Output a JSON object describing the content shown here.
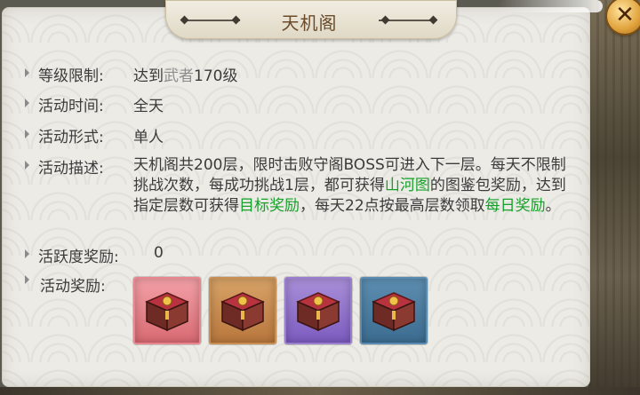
{
  "window": {
    "title": "天机阁",
    "close_symbol": "✕"
  },
  "info": {
    "level_limit": {
      "label": "等级限制:",
      "prefix": "达到",
      "rank": "武者",
      "level": "170级"
    },
    "activity_time": {
      "label": "活动时间:",
      "value": "全天"
    },
    "activity_form": {
      "label": "活动形式:",
      "value": "单人"
    },
    "description": {
      "label": "活动描述:",
      "part1": "天机阁共200层，限时击败守阁BOSS可进入下一层。每天不限制挑战次数，每成功挑战1层，都可获得",
      "highlight1": "山河图",
      "part2": "的图鉴包奖励，达到指定层数可获得",
      "highlight2": "目标奖励",
      "part3": "，每天22点按最高层数领取",
      "highlight3": "每日奖励",
      "part4": "。"
    },
    "activity_points": {
      "label": "活跃度奖励:",
      "value": "0"
    },
    "rewards": {
      "label": "活动奖励:",
      "items": [
        {
          "icon": "treasure-chest-icon",
          "quality_color": "#d96a72"
        },
        {
          "icon": "treasure-chest-icon",
          "quality_color": "#b9773d"
        },
        {
          "icon": "treasure-chest-icon",
          "quality_color": "#7c5cc0"
        },
        {
          "icon": "treasure-chest-icon",
          "quality_color": "#3c6d91"
        }
      ]
    }
  },
  "colors": {
    "highlight": "#16a12a",
    "muted": "#8d8d8d",
    "title": "#6b4b2a"
  }
}
